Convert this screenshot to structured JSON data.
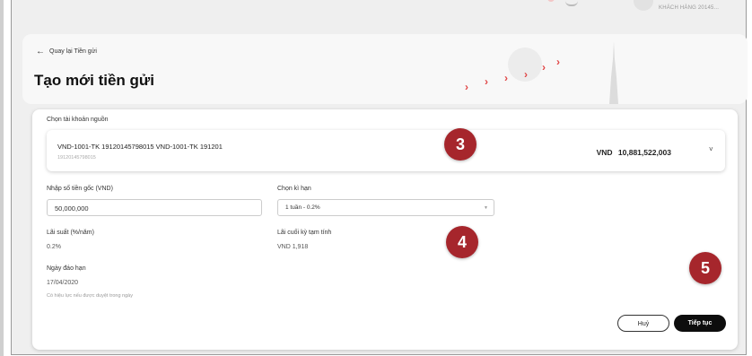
{
  "topbar": {
    "user_label": "KHÁCH HÀNG 20145..."
  },
  "header": {
    "back_label": "Quay lại Tiền gửi",
    "title": "Tạo mới tiền gửi"
  },
  "form": {
    "source_label": "Chọn tài khoản nguồn",
    "account_name": "VND-1001-TK 19120145798015 VND-1001-TK 191201",
    "account_number": "19120145798015",
    "balance_currency": "VND",
    "balance_amount": "10,881,522,003",
    "principal_label": "Nhập số tiền gốc (VND)",
    "principal_value": "50,000,000",
    "term_label": "Chọn kì hạn",
    "term_value": "1 tuần - 0.2%",
    "rate_label": "Lãi suất (%/năm)",
    "rate_value": "0.2%",
    "interest_label": "Lãi cuối kỳ tạm tính",
    "interest_value": "VND 1,918",
    "maturity_label": "Ngày đáo hạn",
    "maturity_value": "17/04/2020",
    "note": "Có hiệu lực nếu được duyệt trong ngày"
  },
  "actions": {
    "cancel_label": "Huỷ",
    "next_label": "Tiếp tục"
  },
  "badges": [
    "3",
    "4",
    "5"
  ],
  "colors": {
    "accent": "#e04646",
    "badge": "#a6262c",
    "primary_button": "#0d0d0d"
  },
  "icons": {
    "back": "arrow-left-icon",
    "dropdown": "chevron-down-icon"
  }
}
